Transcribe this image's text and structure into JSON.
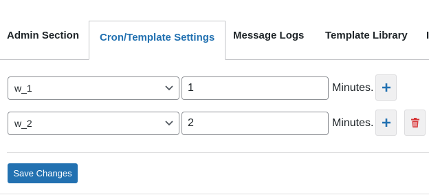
{
  "tabs": [
    {
      "label": "Admin Section",
      "active": false
    },
    {
      "label": "Cron/Template Settings",
      "active": true
    },
    {
      "label": "Message Logs",
      "active": false
    },
    {
      "label": "Template Library",
      "active": false
    }
  ],
  "rows": [
    {
      "template": "w_1",
      "interval": "1",
      "unit": "Minutes.",
      "has_delete": false
    },
    {
      "template": "w_2",
      "interval": "2",
      "unit": "Minutes.",
      "has_delete": true
    }
  ],
  "icons": {
    "add": "plus-icon",
    "delete": "trash-icon",
    "select": "chevron-down-icon"
  },
  "colors": {
    "accent": "#2271b1",
    "danger": "#d63638"
  },
  "save_label": "Save Changes"
}
